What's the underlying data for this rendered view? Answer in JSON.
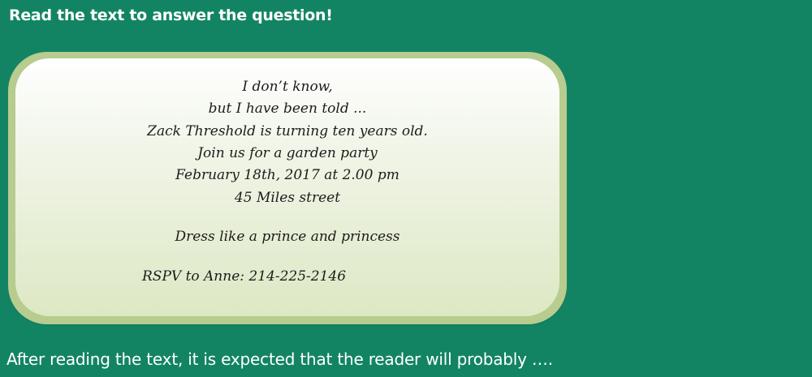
{
  "instruction": "Read the text to answer the question!",
  "invitation": {
    "lines": [
      "I don’t know,",
      "but I have been told ...",
      "Zack Threshold is turning ten years old.",
      "Join us for a garden party",
      "February 18th, 2017 at 2.00 pm",
      "45 Miles street"
    ],
    "dress_code": "Dress like a prince and princess",
    "rsvp": "RSPV to Anne: 214-225-2146"
  },
  "question": "After reading the text, it is expected that the reader will probably …."
}
